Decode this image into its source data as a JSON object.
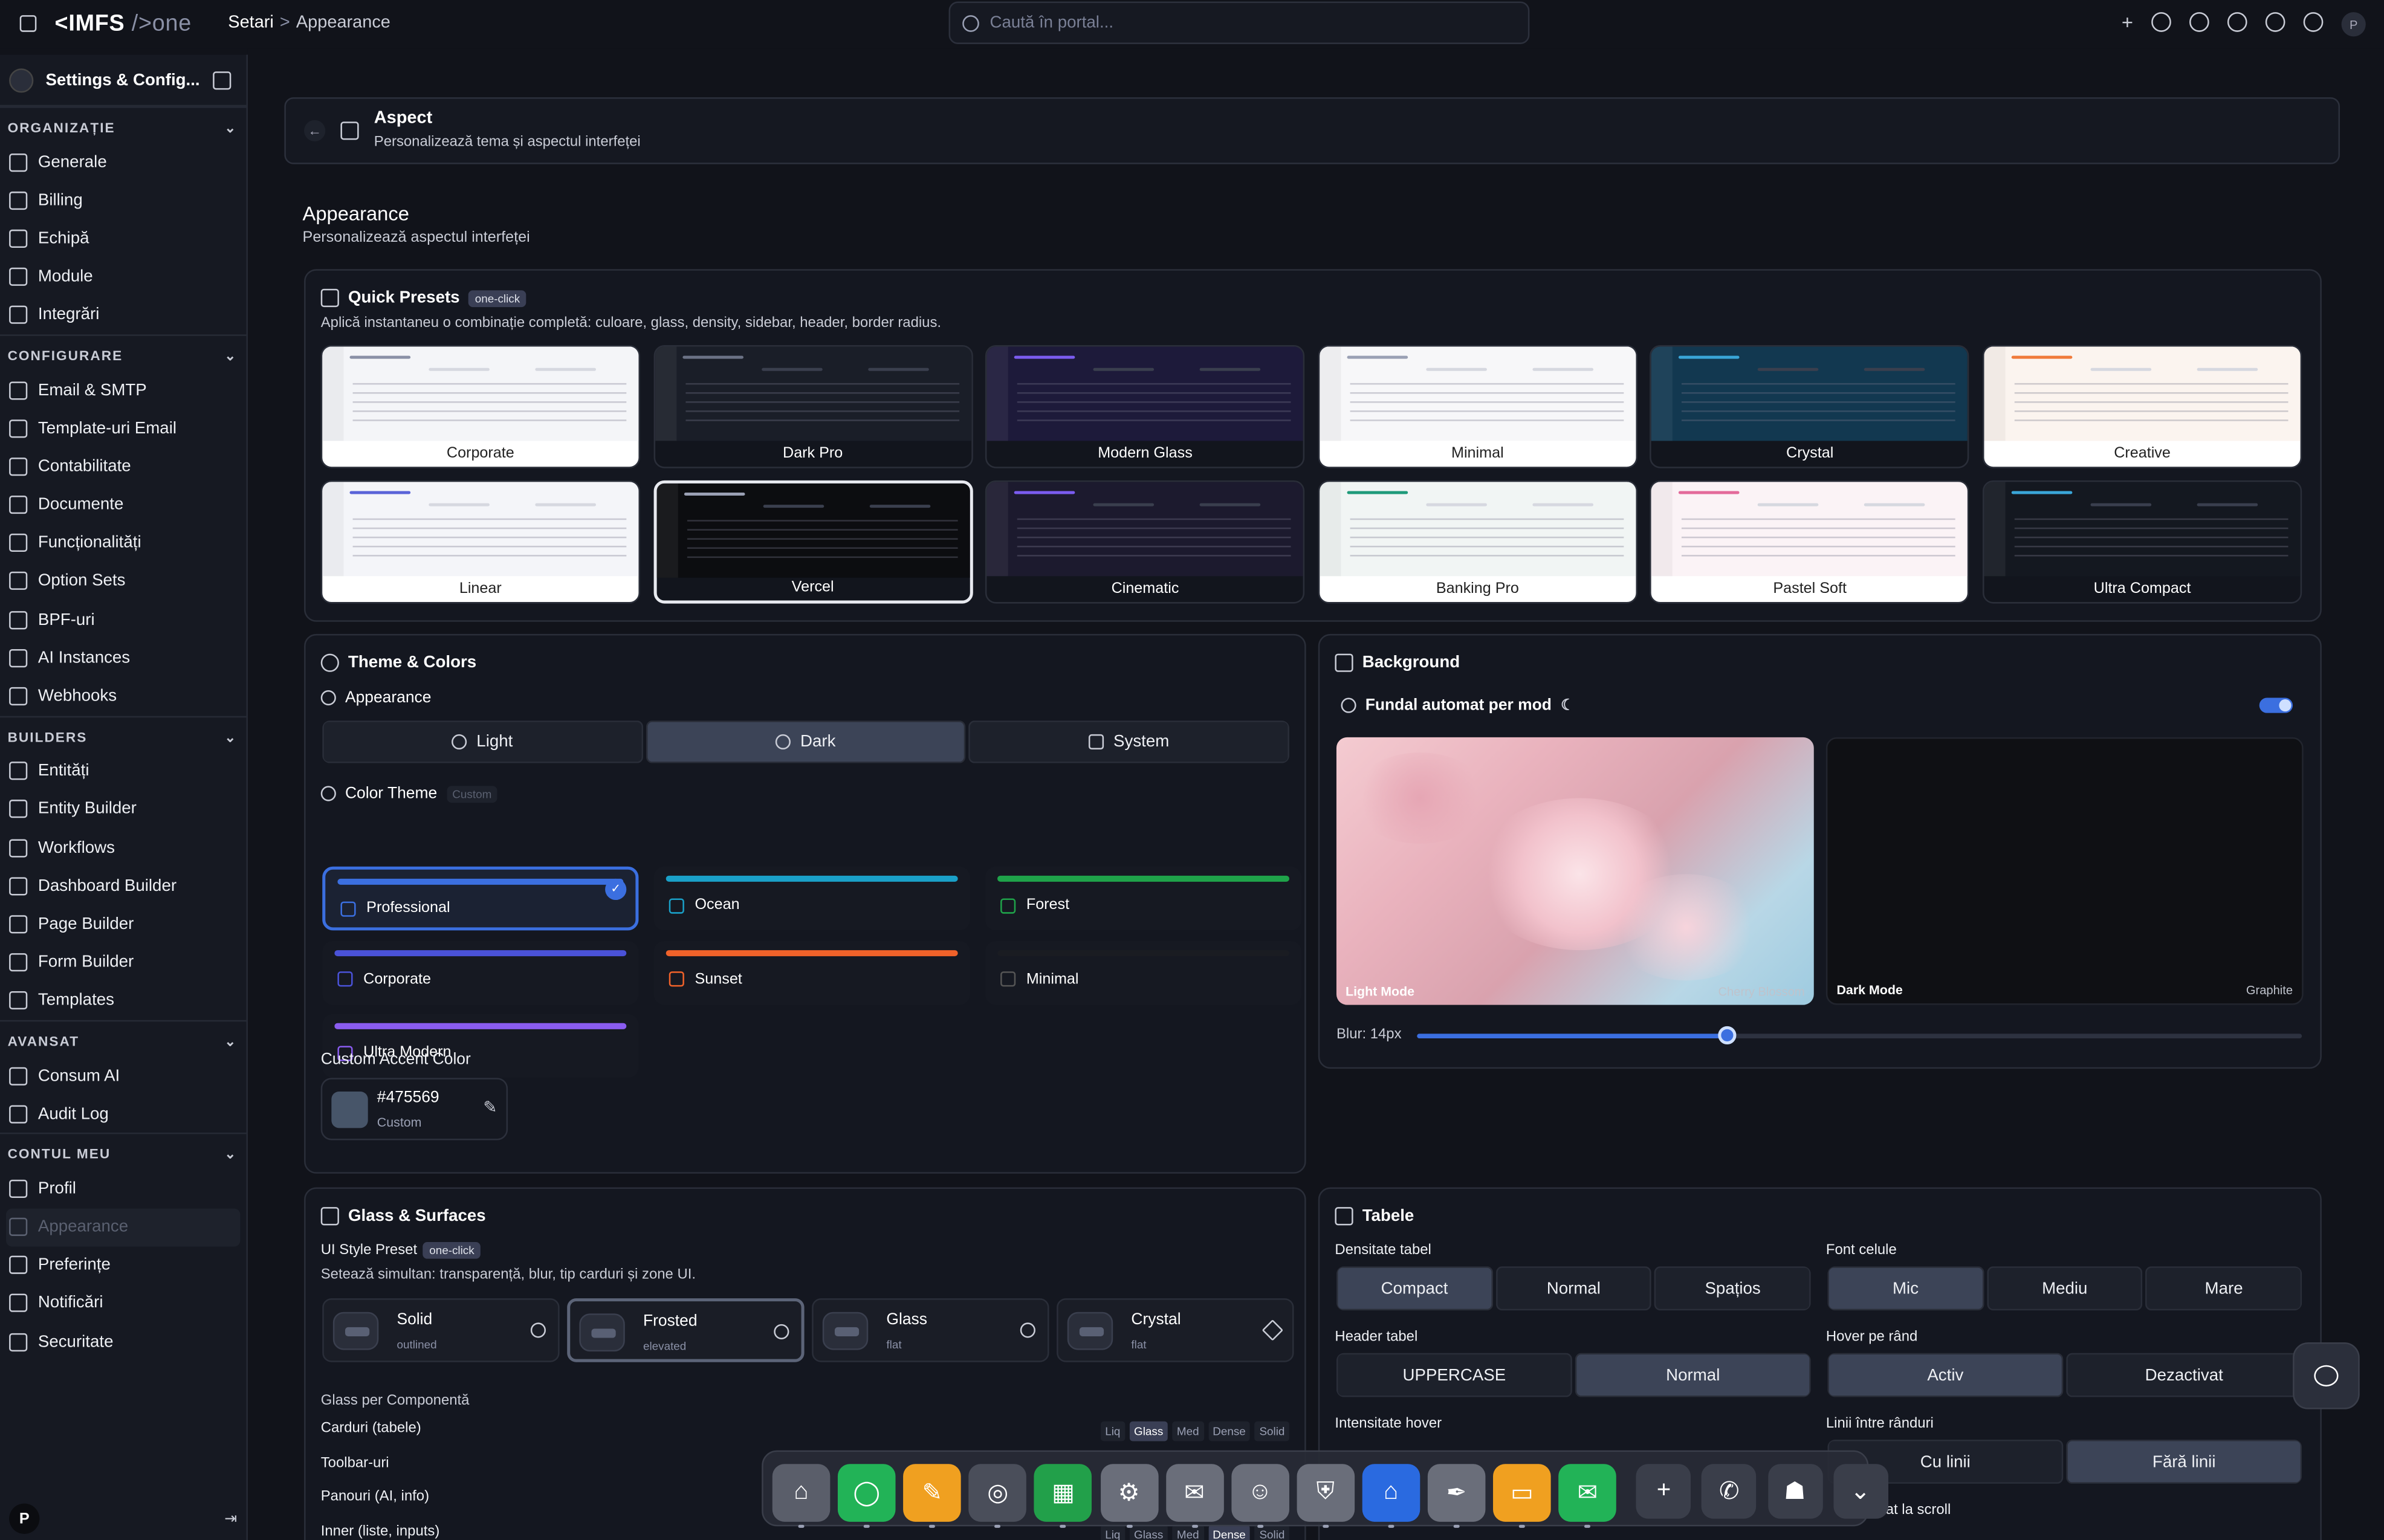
{
  "topbar": {
    "brand_main": "<IMFS",
    "brand_suffix": "/>one",
    "crumb_root": "Setari",
    "crumb_sep": ">",
    "crumb_current": "Appearance",
    "search_placeholder": "Caută în portal...",
    "avatar": "P"
  },
  "sidebar": {
    "title": "Settings & Config...",
    "sections": [
      {
        "name": "ORGANIZAȚIE",
        "items": [
          "Generale",
          "Billing",
          "Echipă",
          "Module",
          "Integrări"
        ]
      },
      {
        "name": "CONFIGURARE",
        "items": [
          "Email & SMTP",
          "Template-uri Email",
          "Contabilitate",
          "Documente",
          "Funcționalități",
          "Option Sets",
          "BPF-uri",
          "AI Instances",
          "Webhooks"
        ]
      },
      {
        "name": "BUILDERS",
        "items": [
          "Entități",
          "Entity Builder",
          "Workflows",
          "Dashboard Builder",
          "Page Builder",
          "Form Builder",
          "Templates"
        ]
      },
      {
        "name": "AVANSAT",
        "items": [
          "Consum AI",
          "Audit Log"
        ]
      },
      {
        "name": "CONTUL MEU",
        "items": [
          "Profil",
          "Appearance",
          "Preferințe",
          "Notificări",
          "Securitate"
        ]
      }
    ],
    "footer_avatar": "P"
  },
  "aspect": {
    "title": "Aspect",
    "subtitle": "Personalizează tema și aspectul interfeței"
  },
  "page": {
    "title": "Appearance",
    "subtitle": "Personalizează aspectul interfeței"
  },
  "quick_presets": {
    "title": "Quick Presets",
    "badge": "one-click",
    "subtitle": "Aplică instantaneu o combinație completă: culoare, glass, density, sidebar, header, border radius.",
    "items": [
      {
        "name": "Corporate",
        "bg": "#f4f5f8",
        "accent": "#8a90a6",
        "dark": false
      },
      {
        "name": "Dark Pro",
        "bg": "#1a1e28",
        "accent": "#6b7285",
        "dark": true
      },
      {
        "name": "Modern Glass",
        "bg": "#1d1a3a",
        "accent": "#7b5cf0",
        "dark": true
      },
      {
        "name": "Minimal",
        "bg": "#f7f7f9",
        "accent": "#9aa0b4",
        "dark": false
      },
      {
        "name": "Crystal",
        "bg": "#123850",
        "accent": "#3aa6d8",
        "dark": true
      },
      {
        "name": "Creative",
        "bg": "#fbf4ef",
        "accent": "#f07a3a",
        "dark": false
      },
      {
        "name": "Linear",
        "bg": "#f4f5f9",
        "accent": "#5a63d8",
        "dark": false
      },
      {
        "name": "Vercel",
        "bg": "#0c0d10",
        "accent": "#9aa0b4",
        "dark": true
      },
      {
        "name": "Cinematic",
        "bg": "#1c1a2e",
        "accent": "#7b5cf0",
        "dark": true
      },
      {
        "name": "Banking Pro",
        "bg": "#f1f5f4",
        "accent": "#1f9a7a",
        "dark": false
      },
      {
        "name": "Pastel Soft",
        "bg": "#fbf3f6",
        "accent": "#e36a9a",
        "dark": false
      },
      {
        "name": "Ultra Compact",
        "bg": "#141820",
        "accent": "#3aa6d8",
        "dark": true
      }
    ]
  },
  "theme": {
    "title": "Theme & Colors",
    "appearance_label": "Appearance",
    "modes": [
      "Light",
      "Dark",
      "System"
    ],
    "mode_selected": "Dark",
    "color_theme_label": "Color Theme",
    "color_theme_badge": "Custom",
    "themes": [
      {
        "name": "Professional",
        "color": "#3b6fe0"
      },
      {
        "name": "Ocean",
        "color": "#1aa0c8"
      },
      {
        "name": "Forest",
        "color": "#1fa34a"
      },
      {
        "name": "Corporate",
        "color": "#4a52d8"
      },
      {
        "name": "Sunset",
        "color": "#f0622a"
      },
      {
        "name": "Minimal",
        "color": "#1a1c22"
      },
      {
        "name": "Ultra Modern",
        "color": "#8a5cf0"
      }
    ],
    "selected": "Professional",
    "accent_label": "Custom Accent Color",
    "accent_hex": "#475569",
    "accent_sub": "Custom"
  },
  "background": {
    "title": "Background",
    "auto_label": "Fundal automat per mod",
    "light_label": "Light Mode",
    "light_name": "Cherry Blossom",
    "dark_label": "Dark Mode",
    "dark_name": "Graphite",
    "blur_label": "Blur: 14px",
    "blur_fraction": 0.35
  },
  "glass": {
    "title": "Glass & Surfaces",
    "preset_label": "UI Style Preset",
    "preset_badge": "one-click",
    "preset_sub": "Setează simultan: transparență, blur, tip carduri și zone UI.",
    "styles": [
      {
        "name": "Solid",
        "desc": "outlined"
      },
      {
        "name": "Frosted",
        "desc": "elevated"
      },
      {
        "name": "Glass",
        "desc": "flat"
      },
      {
        "name": "Crystal",
        "desc": "flat"
      }
    ],
    "selected": "Frosted",
    "per_component_label": "Glass per Componentă",
    "components": [
      {
        "name": "Carduri (tabele)",
        "selected": "Glass"
      },
      {
        "name": "Toolbar-uri",
        "selected": ""
      },
      {
        "name": "Panouri (AI, info)",
        "selected": ""
      },
      {
        "name": "Inner (liste, inputs)",
        "selected": "Dense"
      }
    ],
    "chip_labels": [
      "Liq",
      "Glass",
      "Med",
      "Dense",
      "Solid"
    ]
  },
  "tables": {
    "title": "Tabele",
    "density_label": "Densitate tabel",
    "density": [
      "Compact",
      "Normal",
      "Spațios"
    ],
    "density_sel": "Compact",
    "font_label": "Font celule",
    "font": [
      "Mic",
      "Mediu",
      "Mare"
    ],
    "font_sel": "Mic",
    "header_label": "Header tabel",
    "header": [
      "UPPERCASE",
      "Normal"
    ],
    "header_sel": "Normal",
    "hover_label": "Hover pe rând",
    "hover": [
      "Activ",
      "Dezactivat"
    ],
    "hover_sel": "Activ",
    "intensity_label": "Intensitate hover",
    "lines_label": "Linii între rânduri",
    "lines": [
      "Cu linii",
      "Fără linii"
    ],
    "lines_sel": "Fără linii",
    "scroll_label": "r fixat la scroll"
  },
  "dock": {
    "apps": [
      {
        "name": "home",
        "color": "#5a5e6a",
        "glyph": "⌂"
      },
      {
        "name": "chat",
        "color": "#22b357",
        "glyph": "◯"
      },
      {
        "name": "tools",
        "color": "#f0a020",
        "glyph": "✎"
      },
      {
        "name": "target",
        "color": "#4a4e5a",
        "glyph": "◎"
      },
      {
        "name": "calculator",
        "color": "#22a04a",
        "glyph": "▦"
      },
      {
        "name": "settings",
        "color": "#6a6e7a",
        "glyph": "⚙"
      },
      {
        "name": "mail",
        "color": "#6a6e7a",
        "glyph": "✉"
      },
      {
        "name": "users",
        "color": "#6a6e7a",
        "glyph": "☺"
      },
      {
        "name": "shield",
        "color": "#6a6e7a",
        "glyph": "⛨"
      },
      {
        "name": "bank",
        "color": "#2a6ae0",
        "glyph": "⌂"
      },
      {
        "name": "pen",
        "color": "#6a6e7a",
        "glyph": "✒"
      },
      {
        "name": "folder",
        "color": "#f0a020",
        "glyph": "▭"
      },
      {
        "name": "inbox",
        "color": "#22b357",
        "glyph": "✉"
      },
      {
        "name": "add",
        "color": "#3a3e4a",
        "glyph": "+"
      },
      {
        "name": "phone",
        "color": "#3a3e4a",
        "glyph": "✆"
      },
      {
        "name": "robot",
        "color": "#3a3e4a",
        "glyph": "☗"
      },
      {
        "name": "more",
        "color": "#3a3e4a",
        "glyph": "⌄"
      }
    ]
  }
}
